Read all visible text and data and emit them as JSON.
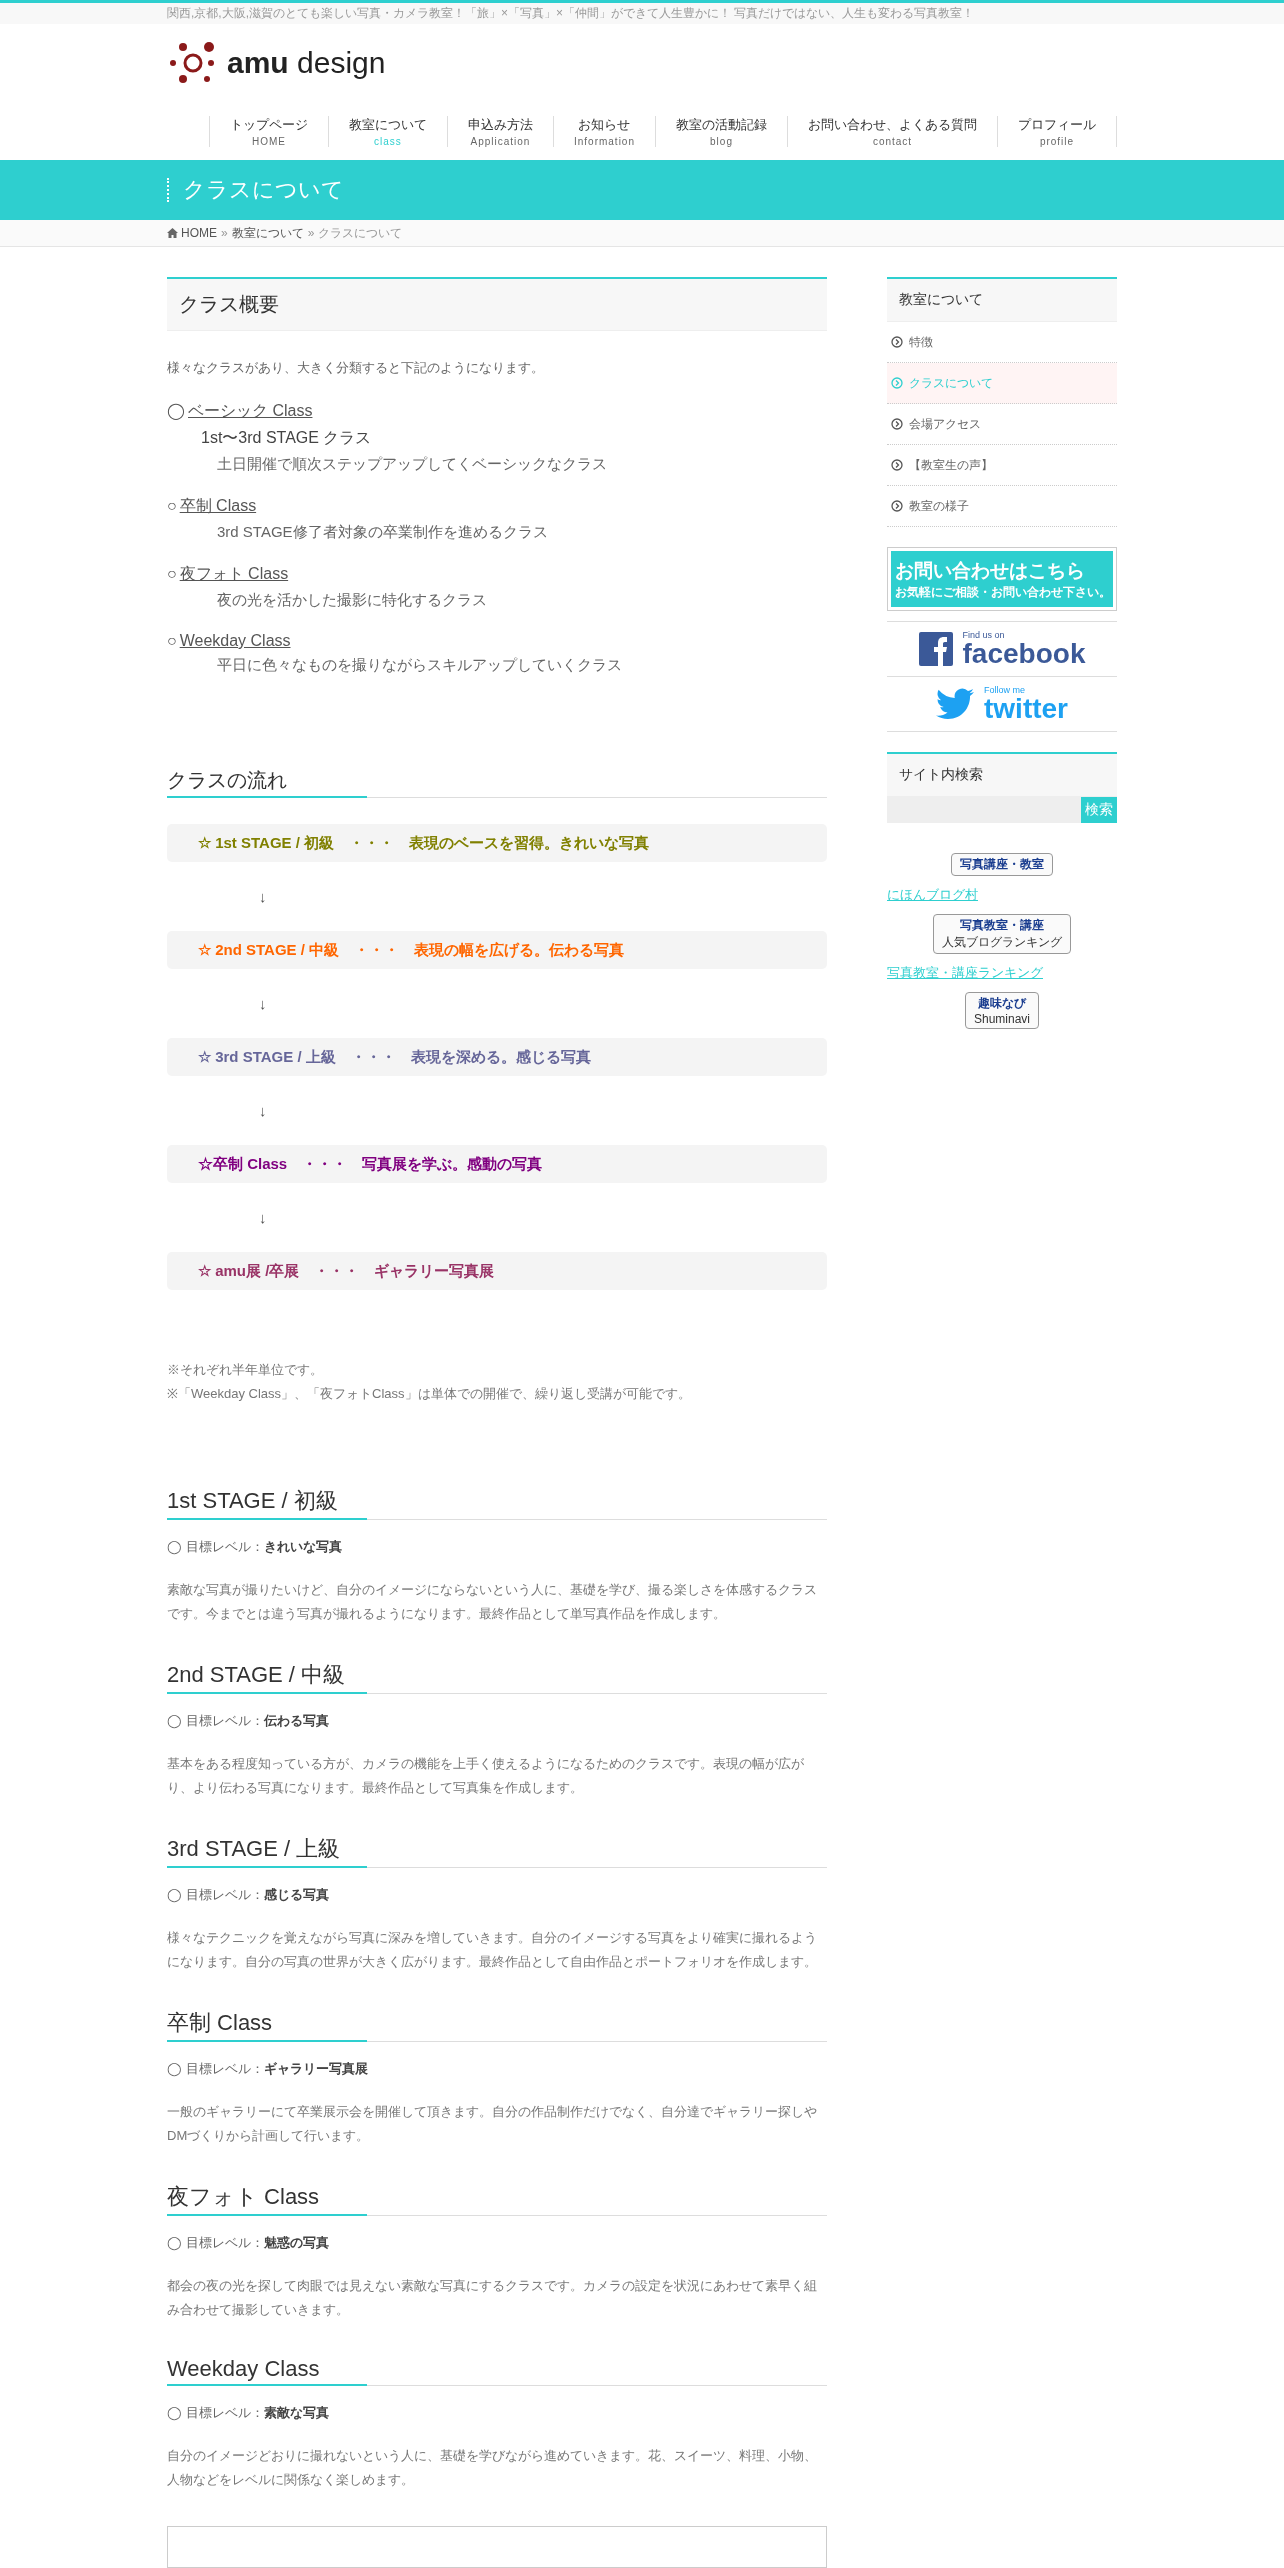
{
  "tagline": "関西,京都,大阪,滋賀のとても楽しい写真・カメラ教室！「旅」×「写真」×「仲間」ができて人生豊かに！ 写真だけではない、人生も変わる写真教室！",
  "logo": {
    "text": "**amu** design"
  },
  "nav": [
    {
      "label": "トップページ",
      "sub": "HOME",
      "selected": false
    },
    {
      "label": "教室について",
      "sub": "class",
      "selected": true
    },
    {
      "label": "申込み方法",
      "sub": "Application",
      "selected": false
    },
    {
      "label": "お知らせ",
      "sub": "Information",
      "selected": false
    },
    {
      "label": "教室の活動記録",
      "sub": "blog",
      "selected": false
    },
    {
      "label": "お問い合わせ、よくある質問",
      "sub": "contact",
      "selected": false
    },
    {
      "label": "プロフィール",
      "sub": "profile",
      "selected": false
    }
  ],
  "banner": {
    "title": "クラスについて"
  },
  "breadcrumb": [
    {
      "label": "HOME",
      "kind": "home"
    },
    {
      "separator": "»",
      "label": "教室について",
      "kind": "link"
    },
    {
      "separator": "»",
      "label": "クラスについて",
      "kind": "current"
    }
  ],
  "overview": {
    "heading": "クラス概要",
    "intro": "様々なクラスがあり、大きく分類すると下記のようになります。",
    "classes": [
      {
        "marker": "◯",
        "name": "ベーシック Class",
        "subtitle": "1st〜3rd STAGE クラス",
        "description": "土日開催で順次ステップアップしてくベーシックなクラス"
      },
      {
        "marker": "○",
        "name": "卒制 Class",
        "description": "3rd STAGE修了者対象の卒業制作を進めるクラス"
      },
      {
        "marker": "○",
        "name": "夜フォト Class",
        "description": "夜の光を活かした撮影に特化するクラス"
      },
      {
        "marker": "○",
        "name": "Weekday Class",
        "description": "平日に色々なものを撮りながらスキルアップしていくクラス"
      }
    ]
  },
  "flow": {
    "heading": "クラスの流れ",
    "steps": [
      {
        "label": "☆ 1st STAGE / 初級　・・・　表現のベースを習得。きれいな写真",
        "color": "#808000",
        "arrow": "↓"
      },
      {
        "label": "☆ 2nd STAGE / 中級　・・・　表現の幅を広げる。伝わる写真",
        "color": "#ff6600",
        "arrow": "↓"
      },
      {
        "label": "☆ 3rd STAGE / 上級　・・・　表現を深める。感じる写真",
        "color": "#666699",
        "arrow": "↓"
      },
      {
        "label": "☆卒制 Class　・・・　写真展を学ぶ。感動の写真",
        "color": "#800080",
        "arrow": "↓"
      },
      {
        "label": "☆ amu展 /卒展　・・・　ギャラリー写真展",
        "color": "#993366"
      }
    ]
  },
  "notes": [
    "※それぞれ半年単位です。",
    "※「Weekday Class」、「夜フォトClass」は単体での開催で、繰り返し受講が可能です。"
  ],
  "stages": [
    {
      "heading": "1st STAGE / 初級",
      "goal": "◯ 目標レベル：**きれいな写真**",
      "text": "素敵な写真が撮りたいけど、自分のイメージにならないという人に、基礎を学び、撮る楽しさを体感するクラスです。今までとは違う写真が撮れるようになります。最終作品として単写真作品を作成します。"
    },
    {
      "heading": "2nd STAGE / 中級",
      "goal": "◯ 目標レベル：**伝わる写真**",
      "text": "基本をある程度知っている方が、カメラの機能を上手く使えるようになるためのクラスです。表現の幅が広がり、より伝わる写真になります。最終作品として写真集を作成します。"
    },
    {
      "heading": "3rd STAGE / 上級",
      "goal": "◯ 目標レベル：**感じる写真**",
      "text": "様々なテクニックを覚えながら写真に深みを増していきます。自分のイメージする写真をより確実に撮れるようになります。自分の写真の世界が大きく広がります。最終作品として自由作品とポートフォリオを作成します。"
    },
    {
      "heading": "卒制 Class",
      "goal": "◯ 目標レベル：**ギャラリー写真展**",
      "text": "一般のギャラリーにて卒業展示会を開催して頂きます。自分の作品制作だけでなく、自分達でギャラリー探しやDMづくりから計画して行います。"
    },
    {
      "heading": "夜フォト Class",
      "goal": "◯ 目標レベル：**魅惑の写真**",
      "text": "都会の夜の光を探して肉眼では見えない素敵な写真にするクラスです。カメラの設定を状況にあわせて素早く組み合わせて撮影していきます。"
    },
    {
      "heading": "Weekday Class",
      "goal": "◯ 目標レベル：**素敵な写真**",
      "text": "自分のイメージどおりに撮れないという人に、基礎を学びながら進めていきます。花、スイーツ、料理、小物、人物などをレベルに関係なく楽しめます。"
    }
  ],
  "sidebar": {
    "menu": {
      "heading": "教室について",
      "items": [
        {
          "label": "特徴",
          "selected": false
        },
        {
          "label": "クラスについて",
          "selected": true
        },
        {
          "label": "会場アクセス",
          "selected": false
        },
        {
          "label": "【教室生の声】",
          "selected": false
        },
        {
          "label": "教室の様子",
          "selected": false
        }
      ]
    },
    "contact_banner": {
      "title": "お問い合わせはこちら",
      "subtitle": "お気軽にご相談・お問い合わせ下さい。"
    },
    "social": [
      {
        "kind": "facebook",
        "caption": "Find us on",
        "name": "facebook"
      },
      {
        "kind": "twitter",
        "caption": "Follow me",
        "name": "twitter"
      }
    ],
    "search": {
      "heading": "サイト内検索",
      "button": "検索"
    },
    "rankings": [
      {
        "kind": "badge",
        "text": "写真講座・教室"
      },
      {
        "kind": "link",
        "text": "にほんブログ村"
      },
      {
        "kind": "badge",
        "text": "写真教室・講座",
        "sub": "人気ブログランキング"
      },
      {
        "kind": "link",
        "text": "写真教室・講座ランキング"
      },
      {
        "kind": "badge",
        "text": "趣味なび",
        "sub": "Shuminavi"
      }
    ]
  }
}
